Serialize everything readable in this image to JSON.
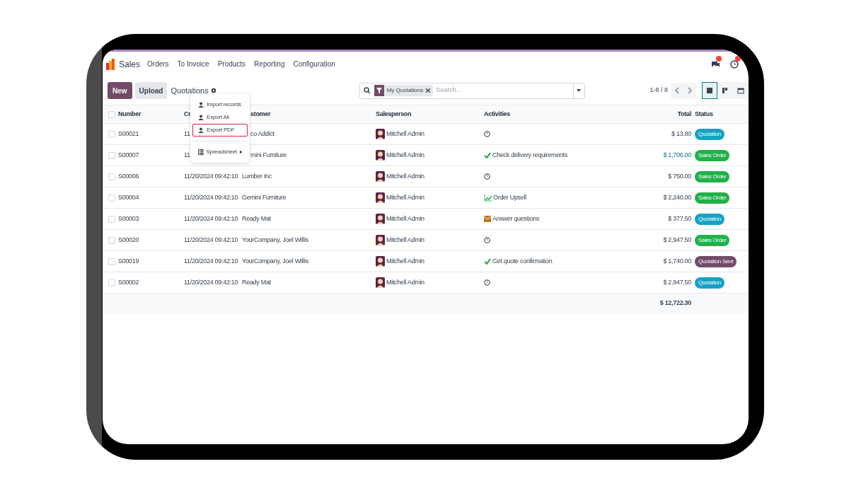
{
  "navbar": {
    "app": "Sales",
    "menu": [
      "Orders",
      "To Invoice",
      "Products",
      "Reporting",
      "Configuration"
    ]
  },
  "control_panel": {
    "buttons": [
      "New",
      "Upload"
    ],
    "title": "Quotations",
    "facet": "My Quotations",
    "search": {
      "placeholder": "Search..."
    },
    "pager": "1-8 / 8",
    "views": [
      {
        "kind": "list",
        "selected": true
      },
      {
        "kind": "kanban",
        "selected": false
      },
      {
        "kind": "calendar",
        "selected": false
      }
    ]
  },
  "menu": [
    {
      "label": "Import records",
      "kind": "upload",
      "selected": false
    },
    {
      "label": "Export All",
      "kind": "export",
      "selected": false
    },
    {
      "label": "Export PDF",
      "kind": "export",
      "selected": true
    },
    {
      "label": "Spreadsheet",
      "kind": "submenu",
      "selected": false
    }
  ],
  "table": {
    "columns": [
      "Number",
      "Cr",
      "stomer",
      "Salesperson",
      "Activities",
      "Total",
      "Status"
    ],
    "all_checked": false,
    "rows": [
      {
        "checked": false,
        "number": "S00021",
        "created": "11",
        "customer": "co Addict",
        "salesperson": "Mitchell Admin",
        "activity": {
          "kind": "clock"
        },
        "total": "$ 13.80",
        "total_highlighted": false,
        "status": {
          "label": "Quotation",
          "color": "#17a2c4"
        }
      },
      {
        "checked": false,
        "number": "S00007",
        "created": "11",
        "customer": "mini Furniture",
        "salesperson": "Mitchell Admin",
        "activity": {
          "kind": "check",
          "text": "Check delivery requirements"
        },
        "total": "$ 1,706.00",
        "total_highlighted": true,
        "status": {
          "label": "Sales Order",
          "color": "#21b14a"
        }
      },
      {
        "checked": false,
        "number": "S00006",
        "created": "11/20/2024 09:42:10",
        "customer": "Lumber Inc",
        "salesperson": "Mitchell Admin",
        "activity": {
          "kind": "clock"
        },
        "total": "$ 750.00",
        "total_highlighted": false,
        "status": {
          "label": "Sales Order",
          "color": "#21b14a"
        }
      },
      {
        "checked": false,
        "number": "S00004",
        "created": "11/20/2024 09:42:10",
        "customer": "Gemini Furniture",
        "salesperson": "Mitchell Admin",
        "activity": {
          "kind": "chart",
          "text": "Order Upsell"
        },
        "total": "$ 2,240.00",
        "total_highlighted": false,
        "status": {
          "label": "Sales Order",
          "color": "#21b14a"
        }
      },
      {
        "checked": false,
        "number": "S00003",
        "created": "11/20/2024 09:42:10",
        "customer": "Ready Mat",
        "salesperson": "Mitchell Admin",
        "activity": {
          "kind": "email",
          "text": "Answer questions"
        },
        "total": "$ 377.50",
        "total_highlighted": false,
        "status": {
          "label": "Quotation",
          "color": "#17a2c4"
        }
      },
      {
        "checked": false,
        "number": "S00020",
        "created": "11/20/2024 09:42:10",
        "customer": "YourCompany, Joel Willis",
        "salesperson": "Mitchell Admin",
        "activity": {
          "kind": "clock"
        },
        "total": "$ 2,947.50",
        "total_highlighted": false,
        "status": {
          "label": "Sales Order",
          "color": "#21b14a"
        }
      },
      {
        "checked": false,
        "number": "S00019",
        "created": "11/20/2024 09:42:10",
        "customer": "YourCompany, Joel Willis",
        "salesperson": "Mitchell Admin",
        "activity": {
          "kind": "check",
          "text": "Get quote confirmation"
        },
        "total": "$ 1,740.00",
        "total_highlighted": false,
        "status": {
          "label": "Quotation Sent",
          "color": "#714b67"
        }
      },
      {
        "checked": false,
        "number": "S00002",
        "created": "11/20/2024 09:42:10",
        "customer": "Ready Mat",
        "salesperson": "Mitchell Admin",
        "activity": {
          "kind": "clock"
        },
        "total": "$ 2,947.50",
        "total_highlighted": false,
        "status": {
          "label": "Quotation",
          "color": "#17a2c4"
        }
      }
    ],
    "sum": "$ 12,722.30"
  }
}
